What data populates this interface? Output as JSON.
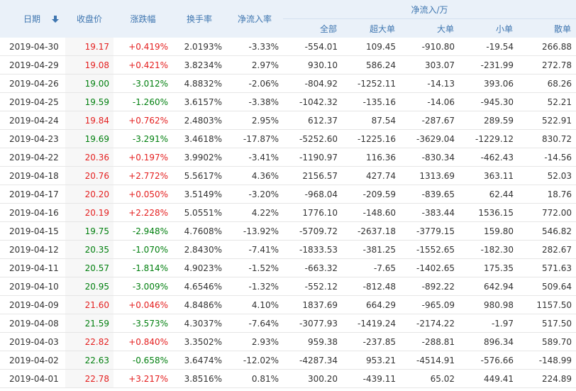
{
  "headers": {
    "date": "日期",
    "close": "收盘价",
    "change": "涨跌幅",
    "turnover": "换手率",
    "net_inflow_rate": "净流入率",
    "net_inflow_group": "净流入/万",
    "all": "全部",
    "super_large": "超大单",
    "large": "大单",
    "small": "小单",
    "retail": "散单"
  },
  "sort_icon": "arrow-down-icon",
  "colors": {
    "up": "#e41f1f",
    "down": "#007f0e",
    "header_text": "#3f76b0",
    "header_bg": "#eaf1f9"
  },
  "rows": [
    {
      "date": "2019-04-30",
      "close": "19.17",
      "change": "+0.419%",
      "turnover": "2.0193%",
      "rate": "-3.33%",
      "all": "-554.01",
      "super": "109.45",
      "large": "-910.80",
      "small": "-19.54",
      "retail": "266.88",
      "dir": "up"
    },
    {
      "date": "2019-04-29",
      "close": "19.08",
      "change": "+0.421%",
      "turnover": "3.8234%",
      "rate": "2.97%",
      "all": "930.10",
      "super": "586.24",
      "large": "303.07",
      "small": "-231.99",
      "retail": "272.78",
      "dir": "up"
    },
    {
      "date": "2019-04-26",
      "close": "19.00",
      "change": "-3.012%",
      "turnover": "4.8832%",
      "rate": "-2.06%",
      "all": "-804.92",
      "super": "-1252.11",
      "large": "-14.13",
      "small": "393.06",
      "retail": "68.26",
      "dir": "down"
    },
    {
      "date": "2019-04-25",
      "close": "19.59",
      "change": "-1.260%",
      "turnover": "3.6157%",
      "rate": "-3.38%",
      "all": "-1042.32",
      "super": "-135.16",
      "large": "-14.06",
      "small": "-945.30",
      "retail": "52.21",
      "dir": "down"
    },
    {
      "date": "2019-04-24",
      "close": "19.84",
      "change": "+0.762%",
      "turnover": "2.4803%",
      "rate": "2.95%",
      "all": "612.37",
      "super": "87.54",
      "large": "-287.67",
      "small": "289.59",
      "retail": "522.91",
      "dir": "up"
    },
    {
      "date": "2019-04-23",
      "close": "19.69",
      "change": "-3.291%",
      "turnover": "3.4618%",
      "rate": "-17.87%",
      "all": "-5252.60",
      "super": "-1225.16",
      "large": "-3629.04",
      "small": "-1229.12",
      "retail": "830.72",
      "dir": "down"
    },
    {
      "date": "2019-04-22",
      "close": "20.36",
      "change": "+0.197%",
      "turnover": "3.9902%",
      "rate": "-3.41%",
      "all": "-1190.97",
      "super": "116.36",
      "large": "-830.34",
      "small": "-462.43",
      "retail": "-14.56",
      "dir": "up"
    },
    {
      "date": "2019-04-18",
      "close": "20.76",
      "change": "+2.772%",
      "turnover": "5.5617%",
      "rate": "4.36%",
      "all": "2156.57",
      "super": "427.74",
      "large": "1313.69",
      "small": "363.11",
      "retail": "52.03",
      "dir": "up"
    },
    {
      "date": "2019-04-17",
      "close": "20.20",
      "change": "+0.050%",
      "turnover": "3.5149%",
      "rate": "-3.20%",
      "all": "-968.04",
      "super": "-209.59",
      "large": "-839.65",
      "small": "62.44",
      "retail": "18.76",
      "dir": "up"
    },
    {
      "date": "2019-04-16",
      "close": "20.19",
      "change": "+2.228%",
      "turnover": "5.0551%",
      "rate": "4.22%",
      "all": "1776.10",
      "super": "-148.60",
      "large": "-383.44",
      "small": "1536.15",
      "retail": "772.00",
      "dir": "up"
    },
    {
      "date": "2019-04-15",
      "close": "19.75",
      "change": "-2.948%",
      "turnover": "4.7608%",
      "rate": "-13.92%",
      "all": "-5709.72",
      "super": "-2637.18",
      "large": "-3779.15",
      "small": "159.80",
      "retail": "546.82",
      "dir": "down"
    },
    {
      "date": "2019-04-12",
      "close": "20.35",
      "change": "-1.070%",
      "turnover": "2.8430%",
      "rate": "-7.41%",
      "all": "-1833.53",
      "super": "-381.25",
      "large": "-1552.65",
      "small": "-182.30",
      "retail": "282.67",
      "dir": "down"
    },
    {
      "date": "2019-04-11",
      "close": "20.57",
      "change": "-1.814%",
      "turnover": "4.9023%",
      "rate": "-1.52%",
      "all": "-663.32",
      "super": "-7.65",
      "large": "-1402.65",
      "small": "175.35",
      "retail": "571.63",
      "dir": "down"
    },
    {
      "date": "2019-04-10",
      "close": "20.95",
      "change": "-3.009%",
      "turnover": "4.6546%",
      "rate": "-1.32%",
      "all": "-552.12",
      "super": "-812.48",
      "large": "-892.22",
      "small": "642.94",
      "retail": "509.64",
      "dir": "down"
    },
    {
      "date": "2019-04-09",
      "close": "21.60",
      "change": "+0.046%",
      "turnover": "4.8486%",
      "rate": "4.10%",
      "all": "1837.69",
      "super": "664.29",
      "large": "-965.09",
      "small": "980.98",
      "retail": "1157.50",
      "dir": "up"
    },
    {
      "date": "2019-04-08",
      "close": "21.59",
      "change": "-3.573%",
      "turnover": "4.3037%",
      "rate": "-7.64%",
      "all": "-3077.93",
      "super": "-1419.24",
      "large": "-2174.22",
      "small": "-1.97",
      "retail": "517.50",
      "dir": "down"
    },
    {
      "date": "2019-04-03",
      "close": "22.82",
      "change": "+0.840%",
      "turnover": "3.3502%",
      "rate": "2.93%",
      "all": "959.38",
      "super": "-237.85",
      "large": "-288.81",
      "small": "896.34",
      "retail": "589.70",
      "dir": "up"
    },
    {
      "date": "2019-04-02",
      "close": "22.63",
      "change": "-0.658%",
      "turnover": "3.6474%",
      "rate": "-12.02%",
      "all": "-4287.34",
      "super": "953.21",
      "large": "-4514.91",
      "small": "-576.66",
      "retail": "-148.99",
      "dir": "down"
    },
    {
      "date": "2019-04-01",
      "close": "22.78",
      "change": "+3.217%",
      "turnover": "3.8516%",
      "rate": "0.81%",
      "all": "300.20",
      "super": "-439.11",
      "large": "65.02",
      "small": "449.41",
      "retail": "224.89",
      "dir": "up"
    }
  ]
}
